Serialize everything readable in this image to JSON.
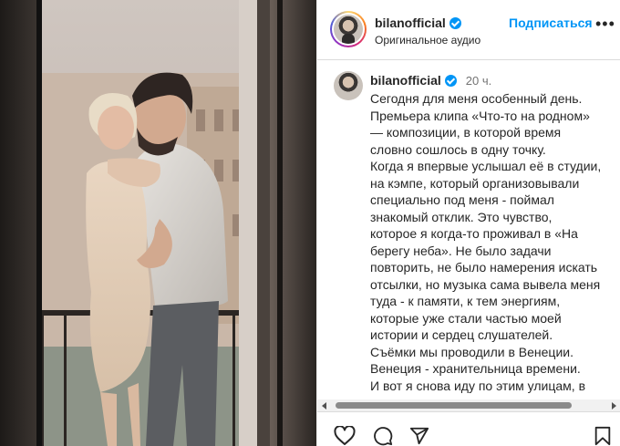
{
  "post": {
    "username": "bilanofficial",
    "audio_label": "Оригинальное аудио",
    "follow_label": "Подписаться",
    "more_label": "•••",
    "time_ago": "20 ч.",
    "caption": "Сегодня для меня особенный день.\nПремьера клипа «Что-то на родном»\n— композиции, в которой время\nсловно сошлось в одну точку.\nКогда я впервые услышал её в студии,\nна кэмпе, который организовывали\nспециально под меня - поймал\nзнакомый отклик. Это чувство,\nкоторое я когда-то проживал в «На\nберегу неба». Не было задачи\nповторить, не было намерения искать\nотсылки, но музыка сама вывела меня\nтуда - к памяти, к тем энергиям,\nкоторые уже стали частью моей\nистории и сердец слушателей.\nСъёмки мы проводили в Венеции.\nВенеция - хранительница времени.\nИ вот я снова иду по этим улицам, в"
  },
  "colors": {
    "accent": "#0095f6",
    "text": "#262626",
    "muted": "#737373",
    "border": "#dbdbdb"
  },
  "icons": {
    "like": "heart-icon",
    "comment": "comment-icon",
    "share": "paper-plane-icon",
    "save": "bookmark-icon",
    "verified": "verified-badge-icon"
  }
}
